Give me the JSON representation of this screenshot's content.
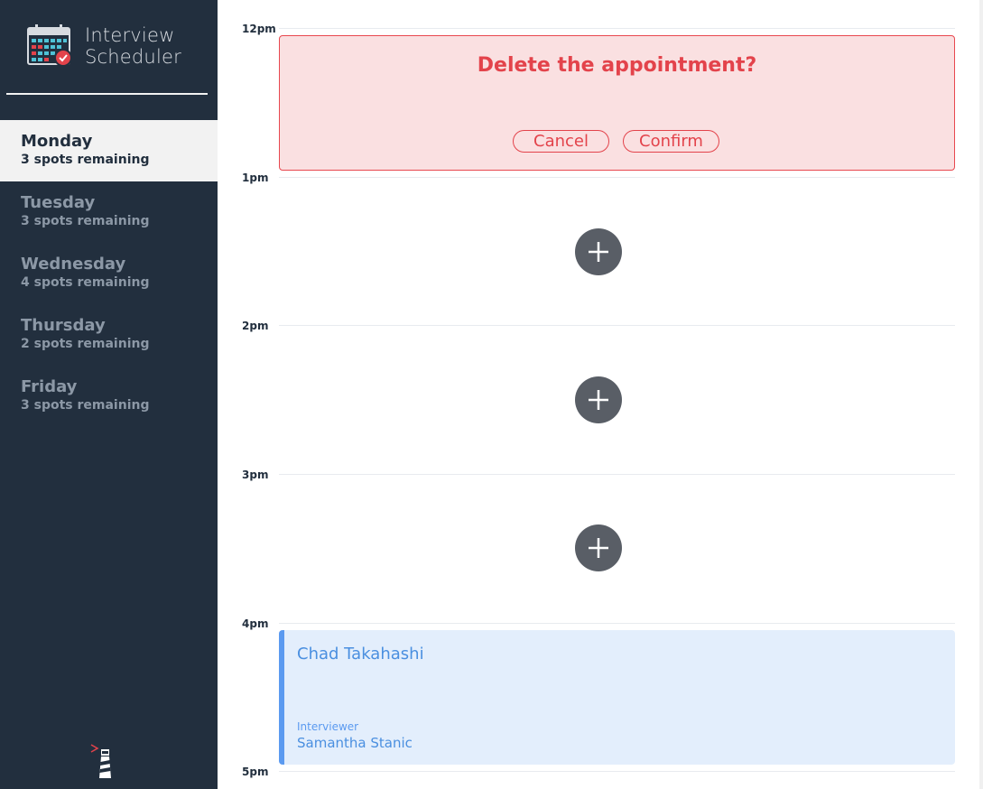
{
  "app": {
    "title_line1": "Interview",
    "title_line2": "Scheduler"
  },
  "days": [
    {
      "name": "Monday",
      "spots": "3 spots remaining",
      "selected": true
    },
    {
      "name": "Tuesday",
      "spots": "3 spots remaining",
      "selected": false
    },
    {
      "name": "Wednesday",
      "spots": "4 spots remaining",
      "selected": false
    },
    {
      "name": "Thursday",
      "spots": "2 spots remaining",
      "selected": false
    },
    {
      "name": "Friday",
      "spots": "3 spots remaining",
      "selected": false
    }
  ],
  "schedule": {
    "hours": [
      "12pm",
      "1pm",
      "2pm",
      "3pm",
      "4pm",
      "5pm"
    ],
    "delete_confirm": {
      "message": "Delete the appointment?",
      "cancel_label": "Cancel",
      "confirm_label": "Confirm"
    },
    "appointment": {
      "student": "Chad Takahashi",
      "interviewer_label": "Interviewer",
      "interviewer_name": "Samantha Stanic"
    }
  },
  "colors": {
    "sidebar_bg": "#222f3e",
    "danger": "#e3434b",
    "danger_bg": "#fae0e1",
    "appointment_bg": "#e3eefc",
    "appointment_accent": "#5b9af0",
    "add_button": "#595e66"
  },
  "icons": {
    "logo": "calendar-icon",
    "add": "plus-icon",
    "footer": "lighthouse-icon"
  }
}
